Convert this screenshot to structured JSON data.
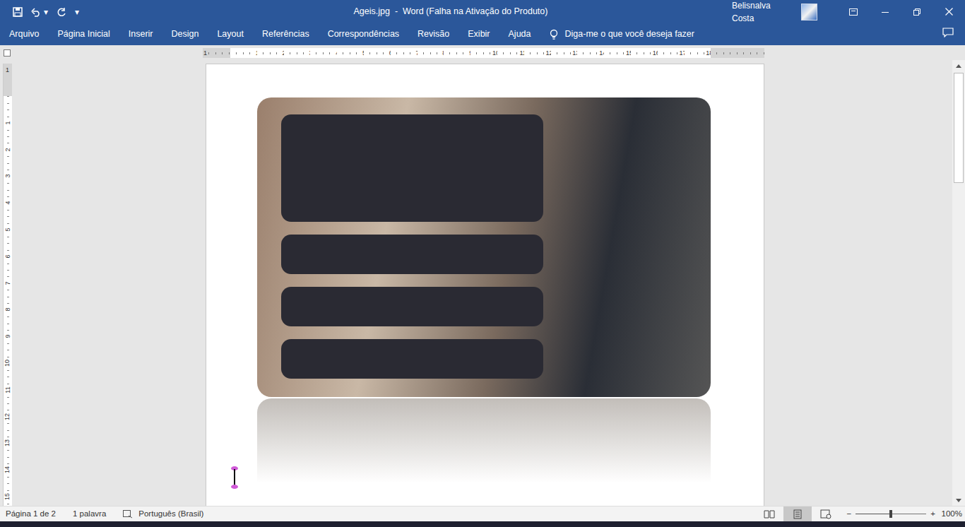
{
  "window": {
    "title": "Ageis.jpg  -  Word (Falha na Ativação do Produto)",
    "user": "Belisnalva Costa",
    "customize": "▾",
    "undo_menu": "▾"
  },
  "ribbon_tabs": [
    "Arquivo",
    "Página Inicial",
    "Inserir",
    "Design",
    "Layout",
    "Referências",
    "Correspondências",
    "Revisão",
    "Exibir",
    "Ajuda"
  ],
  "tell_me": "Diga-me o que você deseja fazer",
  "ruler": {
    "left_margin": "1",
    "horizontal": [
      "1",
      "2",
      "3",
      "4",
      "5",
      "6",
      "7",
      "8",
      "9",
      "10",
      "11",
      "12",
      "13",
      "14",
      "15",
      "16",
      "17",
      "18"
    ],
    "top_margin": "1",
    "vertical": [
      "1",
      "2",
      "3",
      "4",
      "5",
      "6",
      "7",
      "8",
      "9",
      "10",
      "11",
      "12",
      "13",
      "14",
      "15"
    ]
  },
  "status_bar": {
    "page": "Página 1 de 2",
    "words": "1 palavra",
    "language": "Português (Brasil)",
    "views": [
      {
        "selected": false
      },
      {
        "selected": true
      },
      {
        "selected": false
      }
    ],
    "zoom": {
      "minus": "−",
      "plus": "+",
      "level": 0.5,
      "reading": "100%"
    }
  }
}
